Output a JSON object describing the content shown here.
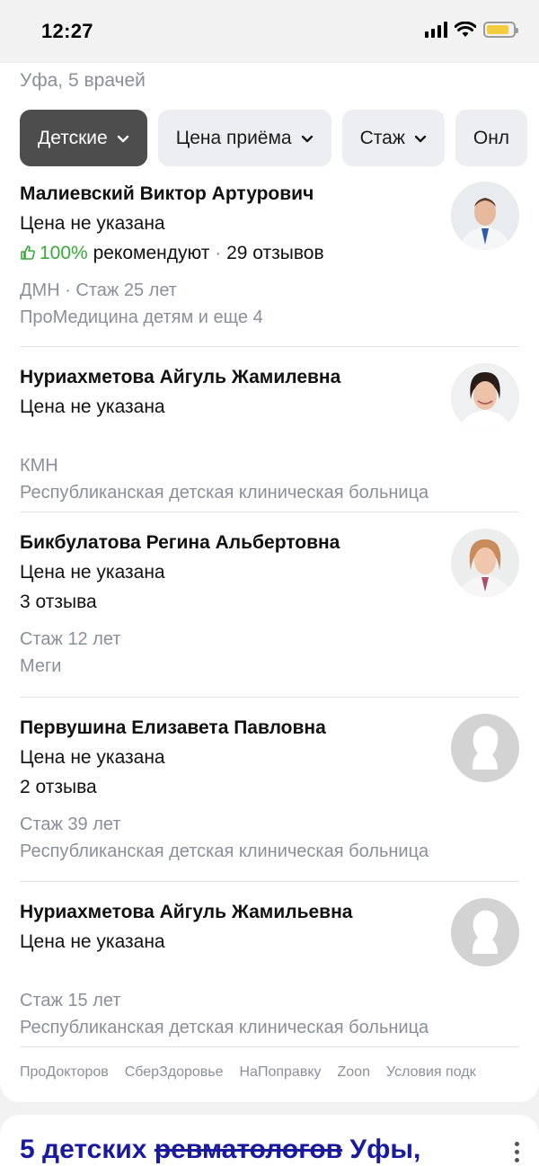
{
  "status": {
    "time": "12:27",
    "battery_level": 0.85
  },
  "subtitle": "Уфа, 5 врачей",
  "filters": [
    {
      "label": "Детские",
      "active": true
    },
    {
      "label": "Цена приёма",
      "active": false
    },
    {
      "label": "Стаж",
      "active": false
    },
    {
      "label": "Онл",
      "active": false
    }
  ],
  "doctors": [
    {
      "name": "Малиевский Виктор Артурович",
      "price": "Цена не указана",
      "rec_percent": "100%",
      "rec_text": "рекомендуют",
      "reviews": "29 отзывов",
      "degree_stage": "ДМН · Стаж 25 лет",
      "clinic": "ПроМедицина детям и еще 4"
    },
    {
      "name": "Нуриахметова Айгуль Жамилевна",
      "price": "Цена не указана",
      "degree_stage": "КМН",
      "clinic": "Республиканская детская клиническая больница"
    },
    {
      "name": "Бикбулатова Регина Альбертовна",
      "price": "Цена не указана",
      "reviews": "3 отзыва",
      "degree_stage": "Стаж 12 лет",
      "clinic": "Меги"
    },
    {
      "name": "Первушина Елизавета Павловна",
      "price": "Цена не указана",
      "reviews": "2 отзыва",
      "degree_stage": "Стаж 39 лет",
      "clinic": "Республиканская детская клиническая больница"
    },
    {
      "name": "Нуриахметова Айгуль Жамильевна",
      "price": "Цена не указана",
      "degree_stage": "Стаж 15 лет",
      "clinic": "Республиканская детская клиническая больница"
    }
  ],
  "sources": [
    "ПроДокторов",
    "СберЗдоровье",
    "НаПоправку",
    "Zoon",
    "Условия подк"
  ],
  "next_card": {
    "title_start": "5 детских ",
    "title_strike": "ревматологов",
    "title_end": " Уфы,"
  },
  "colors": {
    "accent_green": "#3aa83a",
    "chip_active": "#4d4d4d",
    "meta_gray": "#8a8f99",
    "link_blue": "#1a1a9e"
  }
}
